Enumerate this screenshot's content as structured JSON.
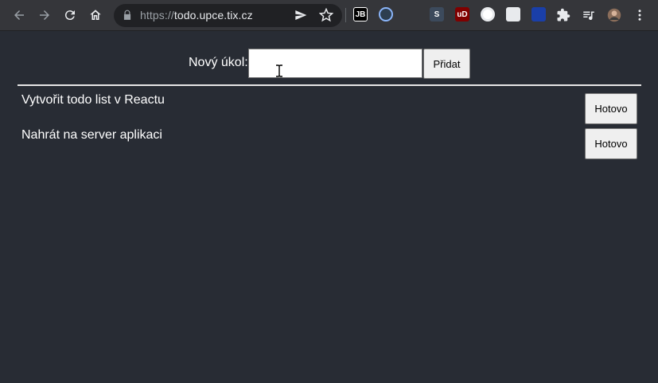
{
  "browser": {
    "url_scheme": "https://",
    "url_host": "todo.upce.tix.cz",
    "extensions": [
      {
        "name": "jetbrains-extension-icon",
        "label": "JB",
        "color": "#000000"
      },
      {
        "name": "media-play-extension-icon",
        "label": "",
        "color": "#2d3e50"
      },
      {
        "name": "gear-extension-icon",
        "label": "",
        "color": "#35363a"
      },
      {
        "name": "s-extension-icon",
        "label": "S",
        "color": "#3c4a5c"
      },
      {
        "name": "ublock-extension-icon",
        "label": "uD",
        "color": "#800000"
      },
      {
        "name": "colorful-circle-extension-icon",
        "label": "",
        "color": "#ffffff"
      },
      {
        "name": "orange-extension-icon",
        "label": "",
        "color": "#e8eaed"
      },
      {
        "name": "blue-book-extension-icon",
        "label": "",
        "color": "#1a3fa8"
      }
    ]
  },
  "form": {
    "label": "Nový úkol:",
    "input_value": "",
    "add_button": "Přidat"
  },
  "tasks": [
    {
      "text": "Vytvořit todo list v Reactu",
      "button": "Hotovo"
    },
    {
      "text": "Nahrát na server aplikaci",
      "button": "Hotovo"
    }
  ]
}
